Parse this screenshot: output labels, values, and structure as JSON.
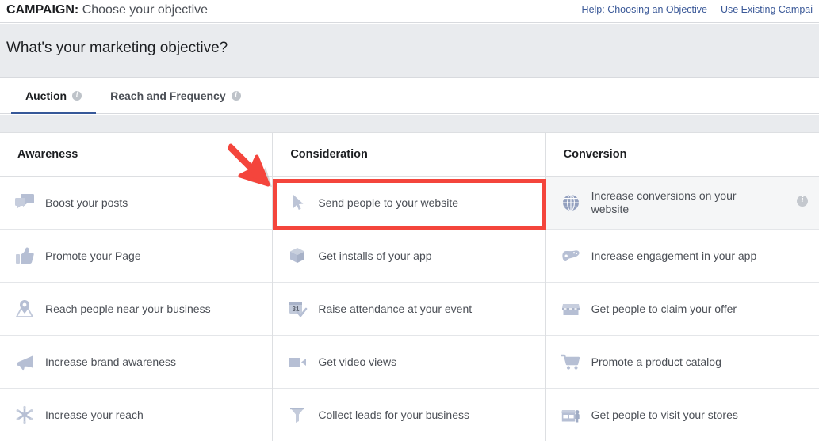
{
  "topbar": {
    "campaign_label": "CAMPAIGN:",
    "campaign_value": "Choose your objective",
    "links": [
      {
        "label": "Help: Choosing an Objective"
      },
      {
        "label": "Use Existing Campai"
      }
    ]
  },
  "banner": {
    "title": "What's your marketing objective?"
  },
  "tabs": [
    {
      "label": "Auction",
      "active": true,
      "has_info": true
    },
    {
      "label": "Reach and Frequency",
      "active": false,
      "has_info": true
    }
  ],
  "columns": [
    {
      "header": "Awareness",
      "items": [
        {
          "label": "Boost your posts",
          "icon": "speech-bubbles-icon"
        },
        {
          "label": "Promote your Page",
          "icon": "thumbs-up-icon"
        },
        {
          "label": "Reach people near your business",
          "icon": "map-pin-icon"
        },
        {
          "label": "Increase brand awareness",
          "icon": "megaphone-icon"
        },
        {
          "label": "Increase your reach",
          "icon": "asterisk-reach-icon"
        }
      ]
    },
    {
      "header": "Consideration",
      "items": [
        {
          "label": "Send people to your website",
          "icon": "cursor-arrow-icon",
          "highlighted": true
        },
        {
          "label": "Get installs of your app",
          "icon": "cube-box-icon"
        },
        {
          "label": "Raise attendance at your event",
          "icon": "calendar-31-icon"
        },
        {
          "label": "Get video views",
          "icon": "video-camera-icon"
        },
        {
          "label": "Collect leads for your business",
          "icon": "funnel-icon"
        }
      ]
    },
    {
      "header": "Conversion",
      "items": [
        {
          "label": "Increase conversions on your website",
          "icon": "globe-icon",
          "hovered": true,
          "has_info": true
        },
        {
          "label": "Increase engagement in your app",
          "icon": "game-controller-icon"
        },
        {
          "label": "Get people to claim your offer",
          "icon": "storefront-icon"
        },
        {
          "label": "Promote a product catalog",
          "icon": "shopping-cart-icon"
        },
        {
          "label": "Get people to visit your stores",
          "icon": "store-person-icon"
        }
      ]
    }
  ],
  "annotations": {
    "highlight_target": "Send people to your website",
    "arrow_color": "#f4453c",
    "highlight_color": "#f4453c"
  },
  "colors": {
    "accent_blue": "#365899",
    "link_blue": "#3b5998",
    "banner_bg": "#e9ebee",
    "icon_blue": "#aeb8d0",
    "text_primary": "#1c1e21",
    "text_secondary": "#4b4f56"
  }
}
